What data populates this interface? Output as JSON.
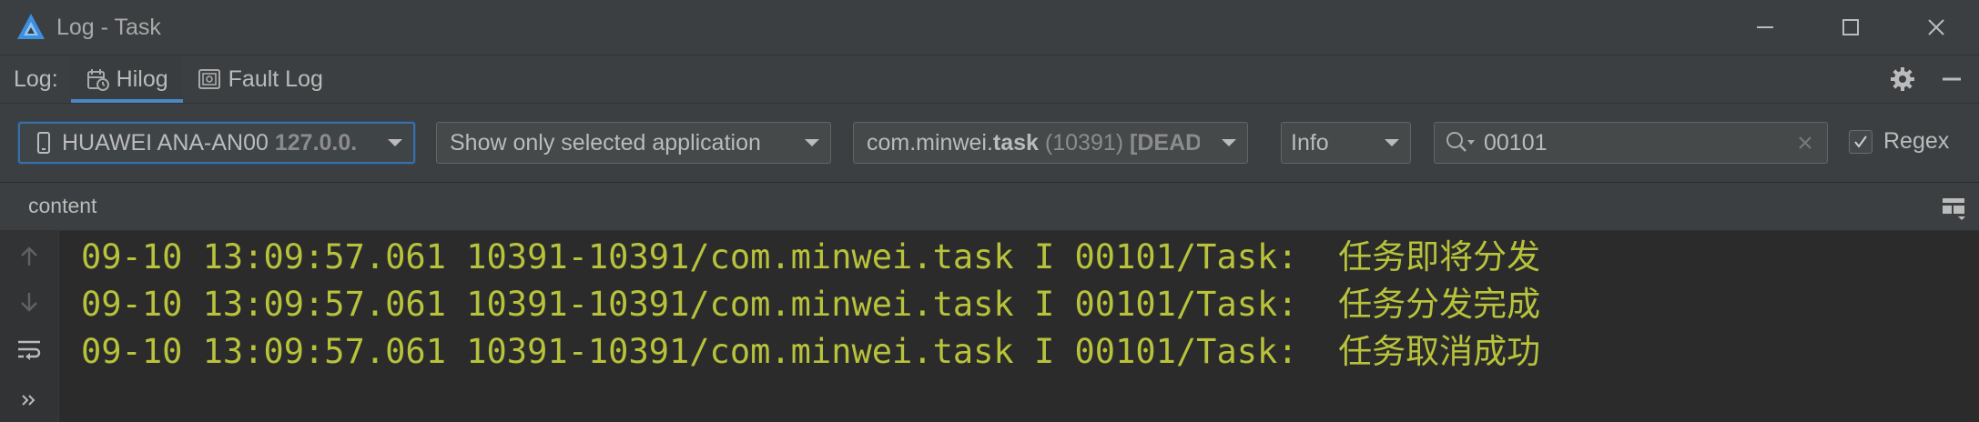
{
  "window": {
    "title": "Log - Task",
    "controls": [
      "minimize-icon",
      "maximize-icon",
      "close-icon"
    ]
  },
  "tabs": {
    "prefix": "Log:",
    "items": [
      {
        "label": "Hilog",
        "icon": "hilog-icon",
        "active": true
      },
      {
        "label": "Fault Log",
        "icon": "fault-log-icon",
        "active": false
      }
    ],
    "right_icons": [
      "gear-icon",
      "minimize-panel-icon"
    ]
  },
  "filters": {
    "device": {
      "name": "HUAWEI ANA-AN00",
      "address": "127.0.0."
    },
    "app_scope": "Show only selected application",
    "process": {
      "prefix": "com.minwei.",
      "name": "task",
      "pid": "(10391)",
      "state": "[DEAD"
    },
    "level": "Info",
    "search": {
      "value": "00101"
    },
    "regex": {
      "label": "Regex",
      "checked": true
    }
  },
  "content": {
    "header": "content"
  },
  "log": {
    "lines": [
      "09-10 13:09:57.061 10391-10391/com.minwei.task I 00101/Task:  任务即将分发",
      "09-10 13:09:57.061 10391-10391/com.minwei.task I 00101/Task:  任务分发完成",
      "09-10 13:09:57.061 10391-10391/com.minwei.task I 00101/Task:  任务取消成功"
    ],
    "color": "#b8c23b"
  },
  "colors": {
    "accent": "#4a88c7",
    "background": "#2b2b2b",
    "panel": "#3c3f41"
  }
}
